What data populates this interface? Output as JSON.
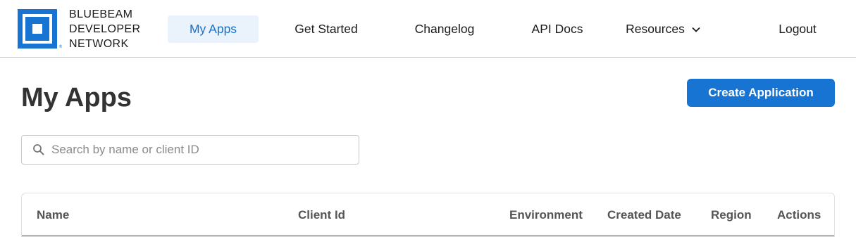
{
  "brand": {
    "line1": "BLUEBEAM",
    "line2": "DEVELOPER",
    "line3": "NETWORK",
    "logo_icon": "bluebeam-logo-icon",
    "color": "#1874d2"
  },
  "nav": {
    "my_apps": "My Apps",
    "get_started": "Get Started",
    "changelog": "Changelog",
    "api_docs": "API Docs",
    "resources": "Resources",
    "logout": "Logout"
  },
  "main": {
    "title": "My Apps",
    "create_button": "Create Application",
    "search": {
      "placeholder": "Search by name or client ID",
      "value": ""
    }
  },
  "table": {
    "columns": [
      "Name",
      "Client Id",
      "Environment",
      "Created Date",
      "Region",
      "Actions"
    ]
  },
  "colors": {
    "accent": "#1874d2",
    "active_nav_bg": "#eaf2fb",
    "active_nav_text": "#1570d0"
  }
}
